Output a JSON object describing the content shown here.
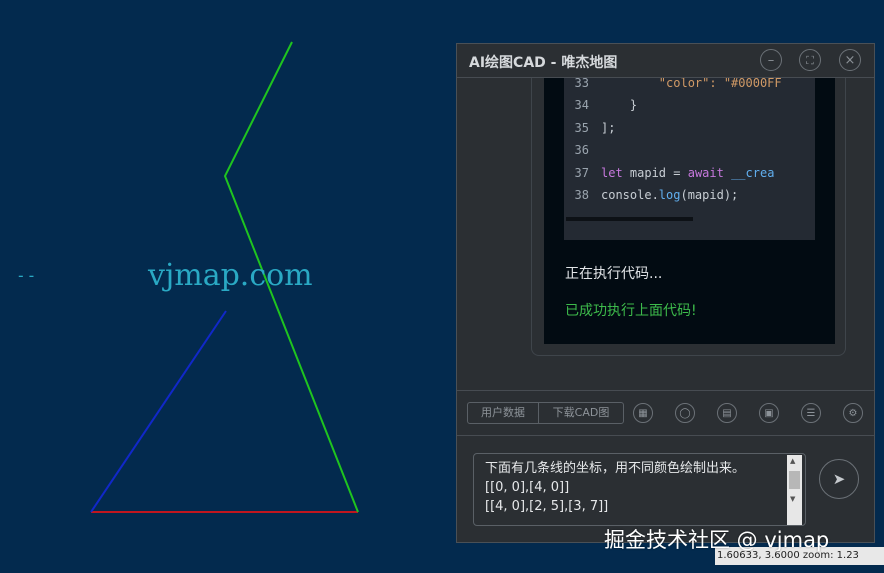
{
  "canvas": {
    "background": "#032a4e",
    "dash_text": "--",
    "watermark_text": "vjmap.com",
    "lines": [
      {
        "name": "red-line",
        "color": "#c0161e"
      },
      {
        "name": "blue-line",
        "color": "#1128c9"
      },
      {
        "name": "green-line",
        "color": "#1fc41f"
      }
    ]
  },
  "panel": {
    "title": "AI绘图CAD - 唯杰地图",
    "buttons": {
      "minimize_icon": "minus-icon",
      "fullscreen_icon": "fullscreen-icon",
      "close_icon": "close-icon"
    }
  },
  "code": {
    "lines": [
      {
        "num": "33",
        "parts": [
          {
            "t": "        \"color\": \"#0000FF",
            "c": "str"
          }
        ]
      },
      {
        "num": "34",
        "parts": [
          {
            "t": "    }",
            "c": "tx"
          }
        ]
      },
      {
        "num": "35",
        "parts": [
          {
            "t": "];",
            "c": "tx"
          }
        ]
      },
      {
        "num": "36",
        "parts": [
          {
            "t": "",
            "c": "tx"
          }
        ]
      },
      {
        "num": "37",
        "parts": [
          {
            "t": "let",
            "c": "kw"
          },
          {
            "t": " mapid = ",
            "c": "tx"
          },
          {
            "t": "await",
            "c": "kw"
          },
          {
            "t": " __crea",
            "c": "fn"
          }
        ]
      },
      {
        "num": "38",
        "parts": [
          {
            "t": "console.",
            "c": "tx"
          },
          {
            "t": "log",
            "c": "fn"
          },
          {
            "t": "(mapid);",
            "c": "tx"
          }
        ]
      }
    ]
  },
  "status": {
    "running": "正在执行代码...",
    "success": "已成功执行上面代码!"
  },
  "toolbar": {
    "user_data": "用户数据",
    "download_cad": "下载CAD图",
    "icons": [
      "grid-icon",
      "chat-icon",
      "document-icon",
      "image-icon",
      "list-icon",
      "settings-icon"
    ]
  },
  "input": {
    "value": "下面有几条线的坐标，用不同颜色绘制出来。\n[[0, 0],[4, 0]]\n[[4, 0],[2, 5],[3, 7]]",
    "send_icon": "send-icon"
  },
  "statusbar": {
    "text": "1.60633, 3.6000 zoom: 1.23"
  },
  "watermark": {
    "text": "掘金技术社区 @ vjmap"
  }
}
